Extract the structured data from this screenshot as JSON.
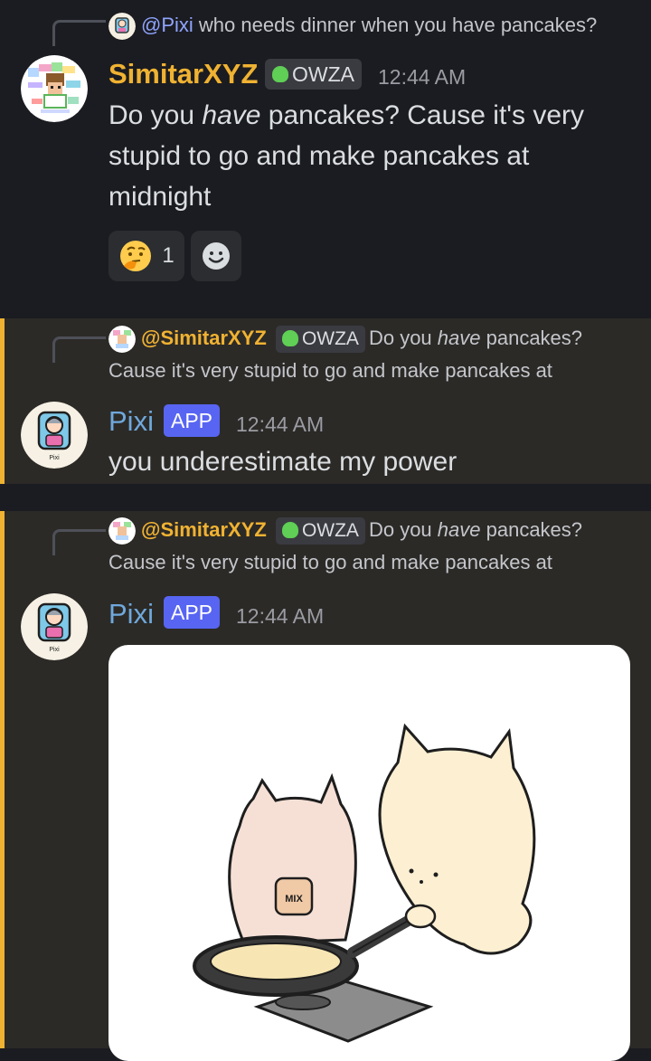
{
  "messages": [
    {
      "reply": {
        "mention": "@Pixi",
        "text": "who needs dinner when you have pancakes?"
      },
      "author": "SimitarXYZ",
      "role": "OWZA",
      "time": "12:44 AM",
      "body": {
        "part1": "Do you ",
        "emph": "have",
        "part2": " pancakes? Cause it's very stupid to go and make pancakes at midnight"
      },
      "reactions": [
        {
          "emoji": "thinking-face",
          "count": "1"
        }
      ],
      "add_reaction_icon": "smiley-add-reaction-icon"
    },
    {
      "reply": {
        "mention": "@SimitarXYZ",
        "role": "OWZA",
        "text1": "Do you ",
        "emph": "have",
        "text2": " pancakes?",
        "line2": "Cause it's very stupid to go and make pancakes at"
      },
      "author": "Pixi",
      "app_badge": "APP",
      "time": "12:44 AM",
      "body": "you underestimate my power"
    },
    {
      "reply": {
        "mention": "@SimitarXYZ",
        "role": "OWZA",
        "text1": "Do you ",
        "emph": "have",
        "text2": " pancakes?",
        "line2": "Cause it's very stupid to go and make pancakes at"
      },
      "author": "Pixi",
      "app_badge": "APP",
      "time": "12:44 AM",
      "image": {
        "mix_label": "MIX",
        "avatar_caption": "Pixi"
      }
    }
  ],
  "colors": {
    "background": "#1b1c21",
    "highlight_bg": "#2c2a27",
    "highlight_bar": "#f0b232",
    "username_gold": "#f0b232",
    "app_badge": "#5865f2",
    "pixi_name": "#6fa8dc"
  }
}
